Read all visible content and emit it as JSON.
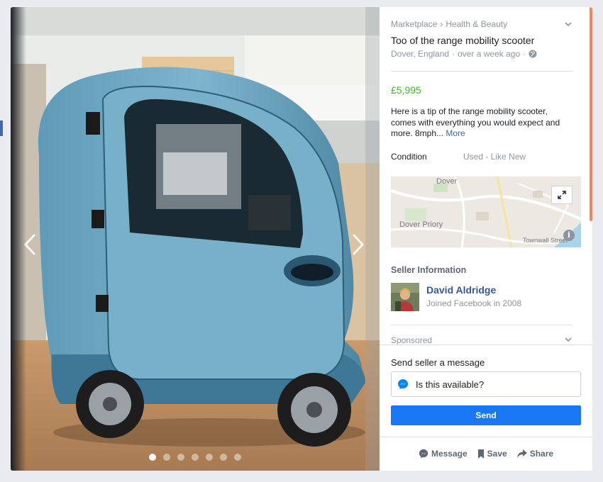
{
  "breadcrumb": {
    "root": "Marketplace",
    "separator": "›",
    "category": "Health & Beauty"
  },
  "listing": {
    "title": "Too of the range mobility scooter",
    "location": "Dover, England",
    "meta_sep": "·",
    "posted": "over a week ago",
    "price": "£5,995",
    "description": "Here is a tip of the range mobility scooter, comes with everything you would expect and more. 8mph...",
    "more_label": "More",
    "condition_label": "Condition",
    "condition_value": "Used - Like New"
  },
  "map": {
    "labels": {
      "city": "Dover",
      "priory": "Dover Priory",
      "street": "Townwall Street"
    },
    "expand_icon": "expand-icon",
    "info_icon": "info-icon"
  },
  "seller": {
    "section_title": "Seller Information",
    "name": "David Aldridge",
    "joined": "Joined Facebook in 2008"
  },
  "sponsored": {
    "label": "Sponsored"
  },
  "message": {
    "label": "Send seller a message",
    "value": "Is this available?",
    "send_label": "Send"
  },
  "actions": {
    "message": "Message",
    "save": "Save",
    "share": "Share"
  },
  "carousel": {
    "total": 7,
    "active_index": 0
  },
  "colors": {
    "price": "#42b72a",
    "accent": "#1877f2",
    "link": "#365899",
    "scroll_accent": "#f0865a"
  }
}
